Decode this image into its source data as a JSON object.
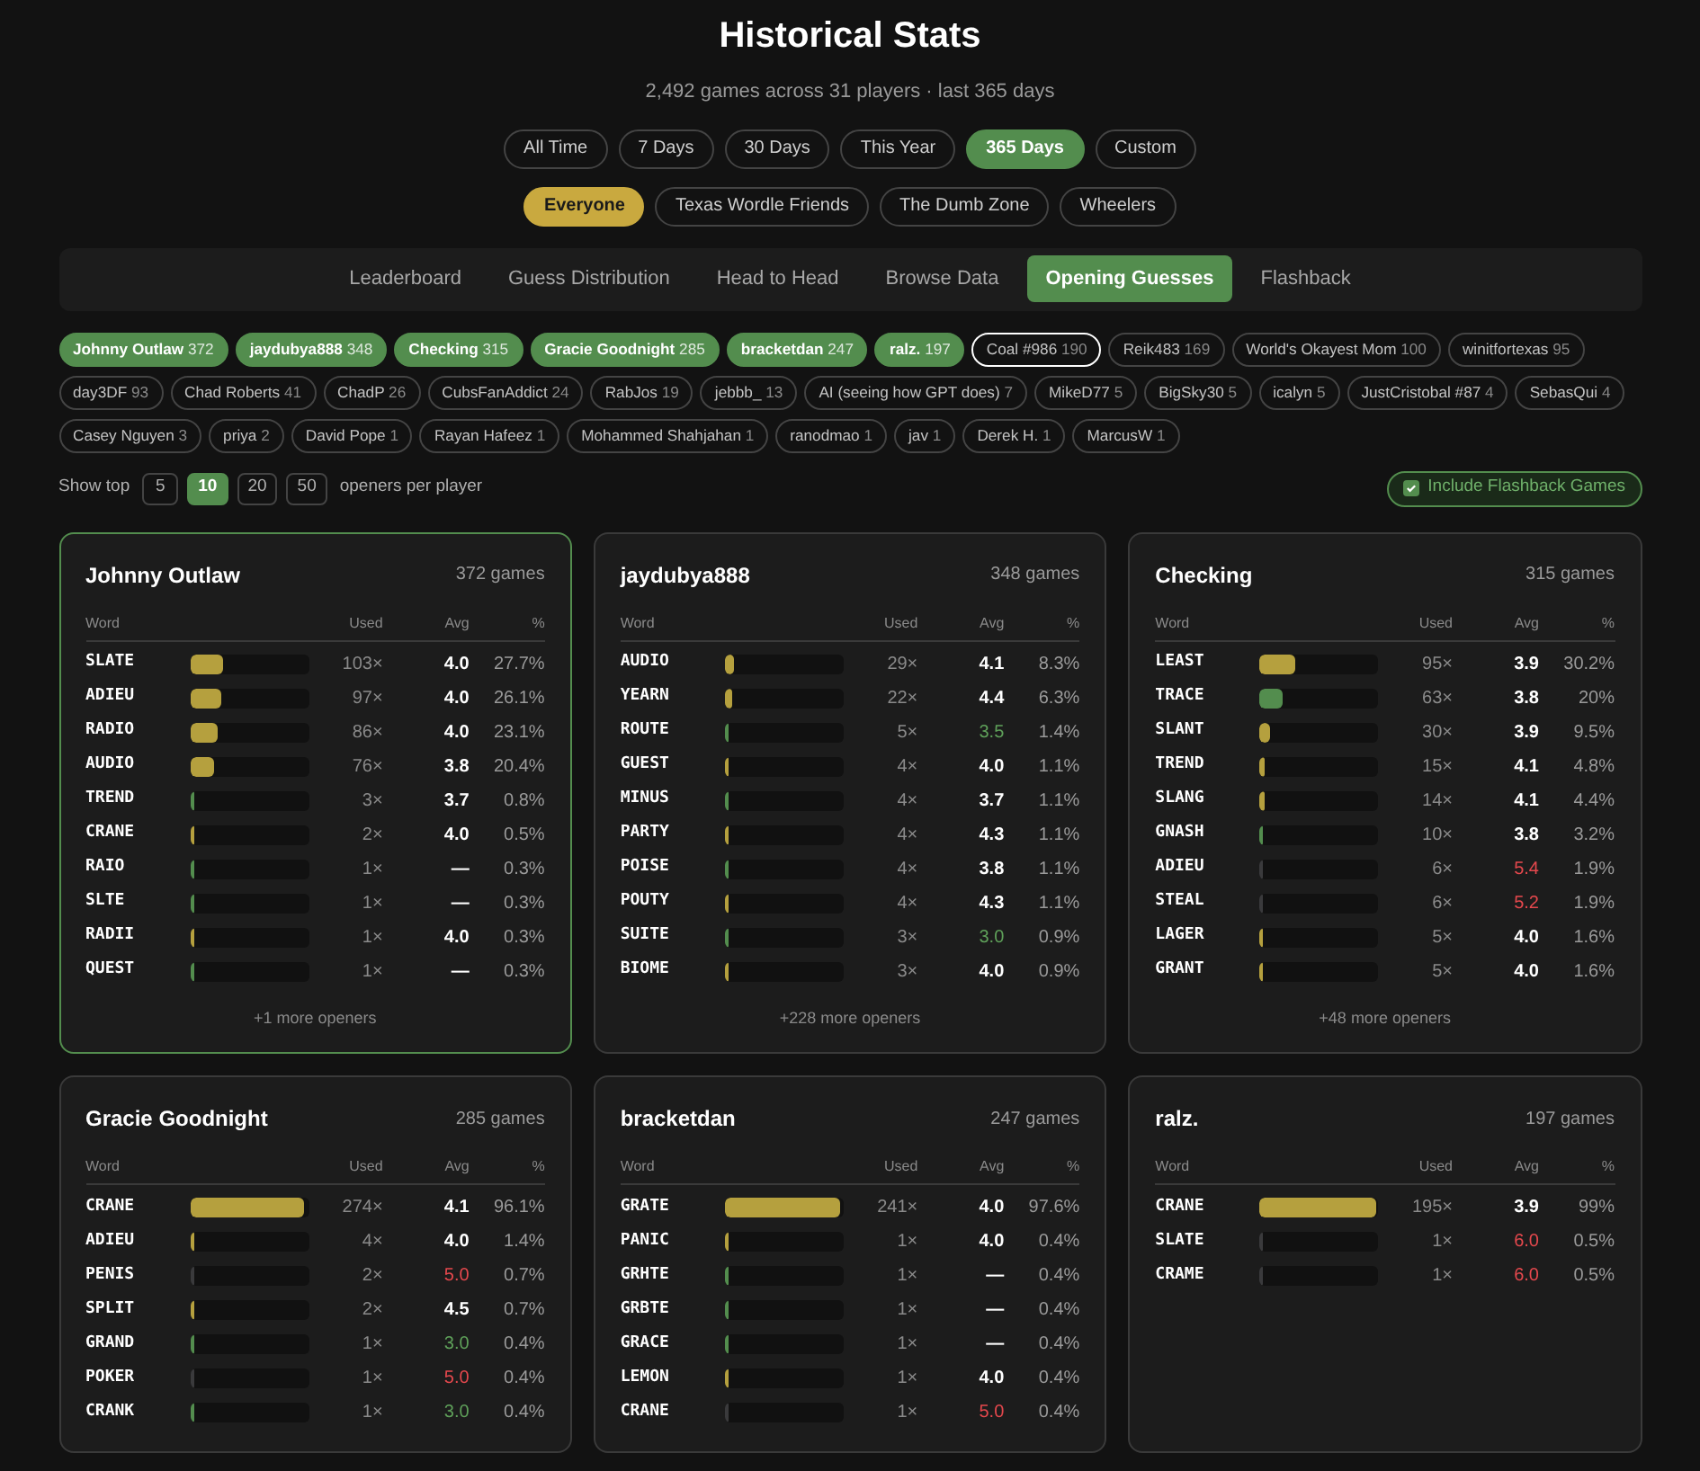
{
  "title": "Historical Stats",
  "subtitle": "2,492 games across 31 players · last 365 days",
  "time_filters": [
    {
      "label": "All Time",
      "selected": false
    },
    {
      "label": "7 Days",
      "selected": false
    },
    {
      "label": "30 Days",
      "selected": false
    },
    {
      "label": "This Year",
      "selected": false
    },
    {
      "label": "365 Days",
      "selected": true
    },
    {
      "label": "Custom",
      "selected": false
    }
  ],
  "group_filters": [
    {
      "label": "Everyone",
      "selected": true
    },
    {
      "label": "Texas Wordle Friends",
      "selected": false
    },
    {
      "label": "The Dumb Zone",
      "selected": false
    },
    {
      "label": "Wheelers",
      "selected": false
    }
  ],
  "tabs": [
    {
      "label": "Leaderboard",
      "selected": false
    },
    {
      "label": "Guess Distribution",
      "selected": false
    },
    {
      "label": "Head to Head",
      "selected": false
    },
    {
      "label": "Browse Data",
      "selected": false
    },
    {
      "label": "Opening Guesses",
      "selected": true
    },
    {
      "label": "Flashback",
      "selected": false
    }
  ],
  "players": [
    {
      "name": "Johnny Outlaw",
      "count": "372",
      "selected": true,
      "outlined": false
    },
    {
      "name": "jaydubya888",
      "count": "348",
      "selected": true,
      "outlined": false
    },
    {
      "name": "Checking",
      "count": "315",
      "selected": true,
      "outlined": false
    },
    {
      "name": "Gracie Goodnight",
      "count": "285",
      "selected": true,
      "outlined": false
    },
    {
      "name": "bracketdan",
      "count": "247",
      "selected": true,
      "outlined": false
    },
    {
      "name": "ralz.",
      "count": "197",
      "selected": true,
      "outlined": false
    },
    {
      "name": "Coal #986",
      "count": "190",
      "selected": false,
      "outlined": true
    },
    {
      "name": "Reik483",
      "count": "169",
      "selected": false,
      "outlined": false
    },
    {
      "name": "World's Okayest Mom",
      "count": "100",
      "selected": false,
      "outlined": false
    },
    {
      "name": "winitfortexas",
      "count": "95",
      "selected": false,
      "outlined": false
    },
    {
      "name": "day3DF",
      "count": "93",
      "selected": false,
      "outlined": false
    },
    {
      "name": "Chad Roberts",
      "count": "41",
      "selected": false,
      "outlined": false
    },
    {
      "name": "ChadP",
      "count": "26",
      "selected": false,
      "outlined": false
    },
    {
      "name": "CubsFanAddict",
      "count": "24",
      "selected": false,
      "outlined": false
    },
    {
      "name": "RabJos",
      "count": "19",
      "selected": false,
      "outlined": false
    },
    {
      "name": "jebbb_",
      "count": "13",
      "selected": false,
      "outlined": false
    },
    {
      "name": "AI (seeing how GPT does)",
      "count": "7",
      "selected": false,
      "outlined": false
    },
    {
      "name": "MikeD77",
      "count": "5",
      "selected": false,
      "outlined": false
    },
    {
      "name": "BigSky30",
      "count": "5",
      "selected": false,
      "outlined": false
    },
    {
      "name": "icalyn",
      "count": "5",
      "selected": false,
      "outlined": false
    },
    {
      "name": "JustCristobal #87",
      "count": "4",
      "selected": false,
      "outlined": false
    },
    {
      "name": "SebasQui",
      "count": "4",
      "selected": false,
      "outlined": false
    },
    {
      "name": "Casey Nguyen",
      "count": "3",
      "selected": false,
      "outlined": false
    },
    {
      "name": "priya",
      "count": "2",
      "selected": false,
      "outlined": false
    },
    {
      "name": "David Pope",
      "count": "1",
      "selected": false,
      "outlined": false
    },
    {
      "name": "Rayan Hafeez",
      "count": "1",
      "selected": false,
      "outlined": false
    },
    {
      "name": "Mohammed Shahjahan",
      "count": "1",
      "selected": false,
      "outlined": false
    },
    {
      "name": "ranodmao",
      "count": "1",
      "selected": false,
      "outlined": false
    },
    {
      "name": "jav",
      "count": "1",
      "selected": false,
      "outlined": false
    },
    {
      "name": "Derek H.",
      "count": "1",
      "selected": false,
      "outlined": false
    },
    {
      "name": "MarcusW",
      "count": "1",
      "selected": false,
      "outlined": false
    }
  ],
  "show_top": {
    "label": "Show top",
    "options": [
      {
        "label": "5",
        "selected": false
      },
      {
        "label": "10",
        "selected": true
      },
      {
        "label": "20",
        "selected": false
      },
      {
        "label": "50",
        "selected": false
      }
    ],
    "suffix": "openers per player"
  },
  "flashback_toggle": {
    "label": "Include Flashback Games",
    "checked": true
  },
  "cards": [
    {
      "player": "Johnny Outlaw",
      "games": "372 games",
      "selected": true,
      "columns": [
        "Word",
        "Used",
        "Avg",
        "%"
      ],
      "more": "+1 more openers",
      "rows": [
        {
          "word": "SLATE",
          "level": 0.277,
          "color": "#b5a03e",
          "used": "103×",
          "avg": "4.0",
          "kind": "normal",
          "pct": "27.7%"
        },
        {
          "word": "ADIEU",
          "level": 0.261,
          "color": "#b5a03e",
          "used": "97×",
          "avg": "4.0",
          "kind": "normal",
          "pct": "26.1%"
        },
        {
          "word": "RADIO",
          "level": 0.231,
          "color": "#b5a03e",
          "used": "86×",
          "avg": "4.0",
          "kind": "normal",
          "pct": "23.1%"
        },
        {
          "word": "AUDIO",
          "level": 0.204,
          "color": "#b5a03e",
          "used": "76×",
          "avg": "3.8",
          "kind": "normal",
          "pct": "20.4%"
        },
        {
          "word": "TREND",
          "level": 0.008,
          "color": "#538d4e",
          "used": "3×",
          "avg": "3.7",
          "kind": "normal",
          "pct": "0.8%"
        },
        {
          "word": "CRANE",
          "level": 0.005,
          "color": "#b5a03e",
          "used": "2×",
          "avg": "4.0",
          "kind": "normal",
          "pct": "0.5%"
        },
        {
          "word": "RAIO",
          "level": 0.003,
          "color": "#538d4e",
          "used": "1×",
          "avg": "—",
          "kind": "normal",
          "pct": "0.3%"
        },
        {
          "word": "SLTE",
          "level": 0.003,
          "color": "#538d4e",
          "used": "1×",
          "avg": "—",
          "kind": "normal",
          "pct": "0.3%"
        },
        {
          "word": "RADII",
          "level": 0.003,
          "color": "#b5a03e",
          "used": "1×",
          "avg": "4.0",
          "kind": "normal",
          "pct": "0.3%"
        },
        {
          "word": "QUEST",
          "level": 0.003,
          "color": "#538d4e",
          "used": "1×",
          "avg": "—",
          "kind": "normal",
          "pct": "0.3%"
        }
      ]
    },
    {
      "player": "jaydubya888",
      "games": "348 games",
      "selected": false,
      "columns": [
        "Word",
        "Used",
        "Avg",
        "%"
      ],
      "more": "+228 more openers",
      "rows": [
        {
          "word": "AUDIO",
          "level": 0.083,
          "color": "#b5a03e",
          "used": "29×",
          "avg": "4.1",
          "kind": "normal",
          "pct": "8.3%"
        },
        {
          "word": "YEARN",
          "level": 0.063,
          "color": "#b5a03e",
          "used": "22×",
          "avg": "4.4",
          "kind": "normal",
          "pct": "6.3%"
        },
        {
          "word": "ROUTE",
          "level": 0.014,
          "color": "#538d4e",
          "used": "5×",
          "avg": "3.5",
          "kind": "good",
          "pct": "1.4%"
        },
        {
          "word": "GUEST",
          "level": 0.011,
          "color": "#b5a03e",
          "used": "4×",
          "avg": "4.0",
          "kind": "normal",
          "pct": "1.1%"
        },
        {
          "word": "MINUS",
          "level": 0.011,
          "color": "#538d4e",
          "used": "4×",
          "avg": "3.7",
          "kind": "normal",
          "pct": "1.1%"
        },
        {
          "word": "PARTY",
          "level": 0.011,
          "color": "#b5a03e",
          "used": "4×",
          "avg": "4.3",
          "kind": "normal",
          "pct": "1.1%"
        },
        {
          "word": "POISE",
          "level": 0.011,
          "color": "#538d4e",
          "used": "4×",
          "avg": "3.8",
          "kind": "normal",
          "pct": "1.1%"
        },
        {
          "word": "POUTY",
          "level": 0.011,
          "color": "#b5a03e",
          "used": "4×",
          "avg": "4.3",
          "kind": "normal",
          "pct": "1.1%"
        },
        {
          "word": "SUITE",
          "level": 0.009,
          "color": "#538d4e",
          "used": "3×",
          "avg": "3.0",
          "kind": "good",
          "pct": "0.9%"
        },
        {
          "word": "BIOME",
          "level": 0.009,
          "color": "#b5a03e",
          "used": "3×",
          "avg": "4.0",
          "kind": "normal",
          "pct": "0.9%"
        }
      ]
    },
    {
      "player": "Checking",
      "games": "315 games",
      "selected": false,
      "columns": [
        "Word",
        "Used",
        "Avg",
        "%"
      ],
      "more": "+48 more openers",
      "rows": [
        {
          "word": "LEAST",
          "level": 0.302,
          "color": "#b5a03e",
          "used": "95×",
          "avg": "3.9",
          "kind": "normal",
          "pct": "30.2%"
        },
        {
          "word": "TRACE",
          "level": 0.2,
          "color": "#538d4e",
          "used": "63×",
          "avg": "3.8",
          "kind": "normal",
          "pct": "20%"
        },
        {
          "word": "SLANT",
          "level": 0.095,
          "color": "#b5a03e",
          "used": "30×",
          "avg": "3.9",
          "kind": "normal",
          "pct": "9.5%"
        },
        {
          "word": "TREND",
          "level": 0.048,
          "color": "#b5a03e",
          "used": "15×",
          "avg": "4.1",
          "kind": "normal",
          "pct": "4.8%"
        },
        {
          "word": "SLANG",
          "level": 0.044,
          "color": "#b5a03e",
          "used": "14×",
          "avg": "4.1",
          "kind": "normal",
          "pct": "4.4%"
        },
        {
          "word": "GNASH",
          "level": 0.032,
          "color": "#538d4e",
          "used": "10×",
          "avg": "3.8",
          "kind": "normal",
          "pct": "3.2%"
        },
        {
          "word": "ADIEU",
          "level": 0.019,
          "color": "#3a3a3c",
          "used": "6×",
          "avg": "5.4",
          "kind": "bad",
          "pct": "1.9%"
        },
        {
          "word": "STEAL",
          "level": 0.019,
          "color": "#3a3a3c",
          "used": "6×",
          "avg": "5.2",
          "kind": "bad",
          "pct": "1.9%"
        },
        {
          "word": "LAGER",
          "level": 0.016,
          "color": "#b5a03e",
          "used": "5×",
          "avg": "4.0",
          "kind": "normal",
          "pct": "1.6%"
        },
        {
          "word": "GRANT",
          "level": 0.016,
          "color": "#b5a03e",
          "used": "5×",
          "avg": "4.0",
          "kind": "normal",
          "pct": "1.6%"
        }
      ]
    },
    {
      "player": "Gracie Goodnight",
      "games": "285 games",
      "selected": false,
      "columns": [
        "Word",
        "Used",
        "Avg",
        "%"
      ],
      "rows": [
        {
          "word": "CRANE",
          "level": 0.961,
          "color": "#b5a03e",
          "used": "274×",
          "avg": "4.1",
          "kind": "normal",
          "pct": "96.1%"
        },
        {
          "word": "ADIEU",
          "level": 0.014,
          "color": "#b5a03e",
          "used": "4×",
          "avg": "4.0",
          "kind": "normal",
          "pct": "1.4%"
        },
        {
          "word": "PENIS",
          "level": 0.007,
          "color": "#3a3a3c",
          "used": "2×",
          "avg": "5.0",
          "kind": "bad",
          "pct": "0.7%"
        },
        {
          "word": "SPLIT",
          "level": 0.007,
          "color": "#b5a03e",
          "used": "2×",
          "avg": "4.5",
          "kind": "normal",
          "pct": "0.7%"
        },
        {
          "word": "GRAND",
          "level": 0.004,
          "color": "#538d4e",
          "used": "1×",
          "avg": "3.0",
          "kind": "good",
          "pct": "0.4%"
        },
        {
          "word": "POKER",
          "level": 0.004,
          "color": "#3a3a3c",
          "used": "1×",
          "avg": "5.0",
          "kind": "bad",
          "pct": "0.4%"
        },
        {
          "word": "CRANK",
          "level": 0.004,
          "color": "#538d4e",
          "used": "1×",
          "avg": "3.0",
          "kind": "good",
          "pct": "0.4%"
        }
      ]
    },
    {
      "player": "bracketdan",
      "games": "247 games",
      "selected": false,
      "columns": [
        "Word",
        "Used",
        "Avg",
        "%"
      ],
      "rows": [
        {
          "word": "GRATE",
          "level": 0.976,
          "color": "#b5a03e",
          "used": "241×",
          "avg": "4.0",
          "kind": "normal",
          "pct": "97.6%"
        },
        {
          "word": "PANIC",
          "level": 0.004,
          "color": "#b5a03e",
          "used": "1×",
          "avg": "4.0",
          "kind": "normal",
          "pct": "0.4%"
        },
        {
          "word": "GRHTE",
          "level": 0.004,
          "color": "#538d4e",
          "used": "1×",
          "avg": "—",
          "kind": "normal",
          "pct": "0.4%"
        },
        {
          "word": "GRBTE",
          "level": 0.004,
          "color": "#538d4e",
          "used": "1×",
          "avg": "—",
          "kind": "normal",
          "pct": "0.4%"
        },
        {
          "word": "GRACE",
          "level": 0.004,
          "color": "#538d4e",
          "used": "1×",
          "avg": "—",
          "kind": "normal",
          "pct": "0.4%"
        },
        {
          "word": "LEMON",
          "level": 0.004,
          "color": "#b5a03e",
          "used": "1×",
          "avg": "4.0",
          "kind": "normal",
          "pct": "0.4%"
        },
        {
          "word": "CRANE",
          "level": 0.004,
          "color": "#3a3a3c",
          "used": "1×",
          "avg": "5.0",
          "kind": "bad",
          "pct": "0.4%"
        }
      ]
    },
    {
      "player": "ralz.",
      "games": "197 games",
      "selected": false,
      "columns": [
        "Word",
        "Used",
        "Avg",
        "%"
      ],
      "rows": [
        {
          "word": "CRANE",
          "level": 0.99,
          "color": "#b5a03e",
          "used": "195×",
          "avg": "3.9",
          "kind": "normal",
          "pct": "99%"
        },
        {
          "word": "SLATE",
          "level": 0.005,
          "color": "#3a3a3c",
          "used": "1×",
          "avg": "6.0",
          "kind": "bad",
          "pct": "0.5%"
        },
        {
          "word": "CRAME",
          "level": 0.005,
          "color": "#3a3a3c",
          "used": "1×",
          "avg": "6.0",
          "kind": "bad",
          "pct": "0.5%"
        }
      ]
    }
  ]
}
